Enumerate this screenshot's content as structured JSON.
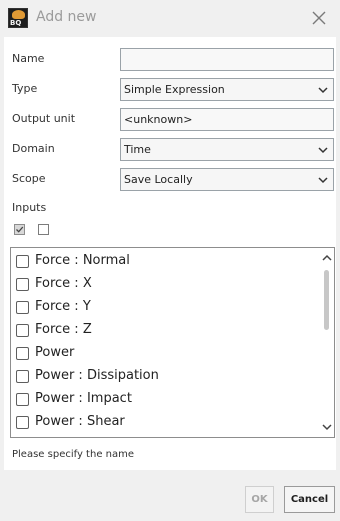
{
  "window": {
    "title": "Add new",
    "app_icon_text": "BQ"
  },
  "form": {
    "name": {
      "label": "Name",
      "value": ""
    },
    "type": {
      "label": "Type",
      "value": "Simple Expression"
    },
    "output_unit": {
      "label": "Output unit",
      "value": "<unknown>"
    },
    "domain": {
      "label": "Domain",
      "value": "Time"
    },
    "scope": {
      "label": "Scope",
      "value": "Save Locally"
    },
    "inputs": {
      "label": "Inputs",
      "select_all_checked": true,
      "select_none_checked": false
    }
  },
  "inputs_list": [
    {
      "label": "Force : Normal",
      "checked": false
    },
    {
      "label": "Force : X",
      "checked": false
    },
    {
      "label": "Force : Y",
      "checked": false
    },
    {
      "label": "Force : Z",
      "checked": false
    },
    {
      "label": "Power",
      "checked": false
    },
    {
      "label": "Power : Dissipation",
      "checked": false
    },
    {
      "label": "Power : Impact",
      "checked": false
    },
    {
      "label": "Power : Shear",
      "checked": false
    }
  ],
  "status_message": "Please specify the name",
  "buttons": {
    "ok": "OK",
    "cancel": "Cancel"
  },
  "icons": {
    "close": "close-icon",
    "dropdown": "chevron-down-icon",
    "check": "checkmark-icon",
    "scroll_up": "chevron-up-icon",
    "scroll_down": "chevron-down-icon"
  },
  "colors": {
    "background": "#f0f0f0",
    "panel": "#ffffff",
    "field_border": "#9aa2a8",
    "disabled_text": "#a6a6a6"
  }
}
